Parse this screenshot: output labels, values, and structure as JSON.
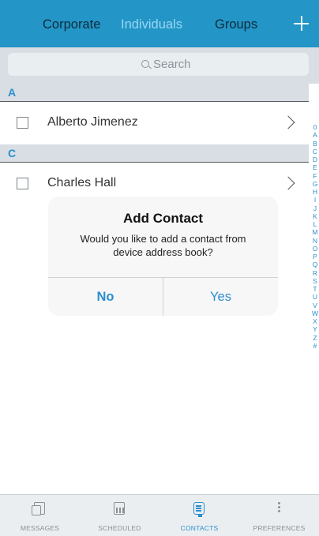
{
  "header": {
    "tabs": [
      {
        "label": "Corporate",
        "active": false
      },
      {
        "label": "Individuals",
        "active": true
      },
      {
        "label": "Groups",
        "active": false
      }
    ],
    "add_icon": "plus-icon",
    "color": "#2395c7"
  },
  "search": {
    "placeholder": "Search",
    "icon": "search-icon"
  },
  "contacts": {
    "sections": [
      {
        "letter": "A",
        "items": [
          {
            "name": "Alberto Jimenez"
          }
        ]
      },
      {
        "letter": "C",
        "items": [
          {
            "name": "Charles Hall"
          }
        ]
      }
    ]
  },
  "alpha_index": [
    "0",
    "A",
    "B",
    "C",
    "D",
    "E",
    "F",
    "G",
    "H",
    "I",
    "J",
    "K",
    "L",
    "M",
    "N",
    "O",
    "P",
    "Q",
    "R",
    "S",
    "T",
    "U",
    "V",
    "W",
    "X",
    "Y",
    "Z",
    "#"
  ],
  "dialog": {
    "title": "Add Contact",
    "message": "Would you like to add a contact from device address book?",
    "no_label": "No",
    "yes_label": "Yes"
  },
  "tabbar": {
    "items": [
      {
        "label": "MESSAGES",
        "icon": "messages-icon",
        "active": false
      },
      {
        "label": "SCHEDULED",
        "icon": "calendar-icon",
        "active": false
      },
      {
        "label": "CONTACTS",
        "icon": "contacts-icon",
        "active": true
      },
      {
        "label": "PREFERENCES",
        "icon": "more-vertical-icon",
        "active": false
      }
    ]
  },
  "colors": {
    "accent": "#2b8fcf",
    "section_bg": "#d8dee3",
    "inactive_tab": "#8a9094"
  }
}
